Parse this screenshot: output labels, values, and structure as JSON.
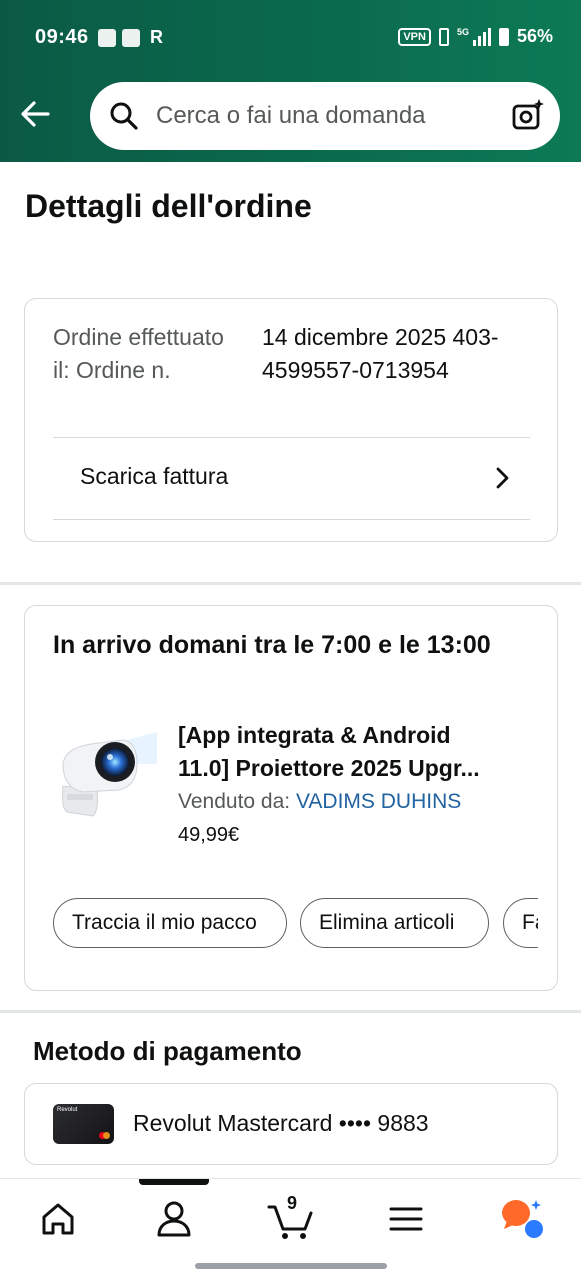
{
  "status_bar": {
    "time": "09:46",
    "carrier_letter": "R",
    "vpn_label": "VPN",
    "network_tag": "5G",
    "battery": "56%"
  },
  "header": {
    "back_icon": "arrow-left-icon",
    "search_placeholder": "Cerca o fai una domanda",
    "camera_icon": "camera-ai-icon"
  },
  "page": {
    "title": "Dettagli dell'ordine"
  },
  "order": {
    "labels": "Ordine effettuato il: Ordine n.",
    "values": "14 dicembre 2025 403-4599557-0713954",
    "invoice_label": "Scarica fattura"
  },
  "shipment": {
    "delivery_text": "In arrivo domani tra le 7:00 e le 13:00",
    "product_title_line1": "[App integrata & Android",
    "product_title_line2": "11.0] Proiettore 2025 Upgr...",
    "sold_by_label": "Venduto da:",
    "seller_name": "VADIMS DUHINS",
    "price": "49,99€",
    "actions": [
      "Traccia il mio pacco",
      "Elimina articoli",
      "Fa"
    ]
  },
  "payment": {
    "title": "Metodo di pagamento",
    "card_brand": "Revolut",
    "card_label": "Revolut Mastercard •••• 9883"
  },
  "bottom_nav": {
    "cart_count": "9",
    "items": [
      "home-icon",
      "account-icon",
      "cart-icon",
      "menu-icon",
      "rufus-assistant-icon"
    ]
  },
  "colors": {
    "header_green": "#0a6a4d",
    "link_blue": "#2162a1",
    "rufus_orange": "#ff6a2b",
    "rufus_blue": "#2b7bff"
  }
}
